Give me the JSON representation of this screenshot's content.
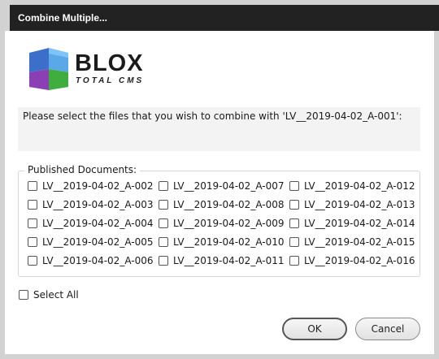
{
  "window": {
    "title": "Combine Multiple..."
  },
  "logo": {
    "word": "BLOX",
    "subtitle": "TOTAL CMS"
  },
  "prompt": {
    "text": "Please select the files that you wish to combine with 'LV__2019-04-02_A-001':"
  },
  "published": {
    "legend": "Published Documents:",
    "columns": [
      [
        "LV__2019-04-02_A-002",
        "LV__2019-04-02_A-003",
        "LV__2019-04-02_A-004",
        "LV__2019-04-02_A-005",
        "LV__2019-04-02_A-006"
      ],
      [
        "LV__2019-04-02_A-007",
        "LV__2019-04-02_A-008",
        "LV__2019-04-02_A-009",
        "LV__2019-04-02_A-010",
        "LV__2019-04-02_A-011"
      ],
      [
        "LV__2019-04-02_A-012",
        "LV__2019-04-02_A-013",
        "LV__2019-04-02_A-014",
        "LV__2019-04-02_A-015",
        "LV__2019-04-02_A-016"
      ]
    ]
  },
  "select_all": {
    "label": "Select All",
    "checked": false
  },
  "buttons": {
    "ok": "OK",
    "cancel": "Cancel"
  }
}
